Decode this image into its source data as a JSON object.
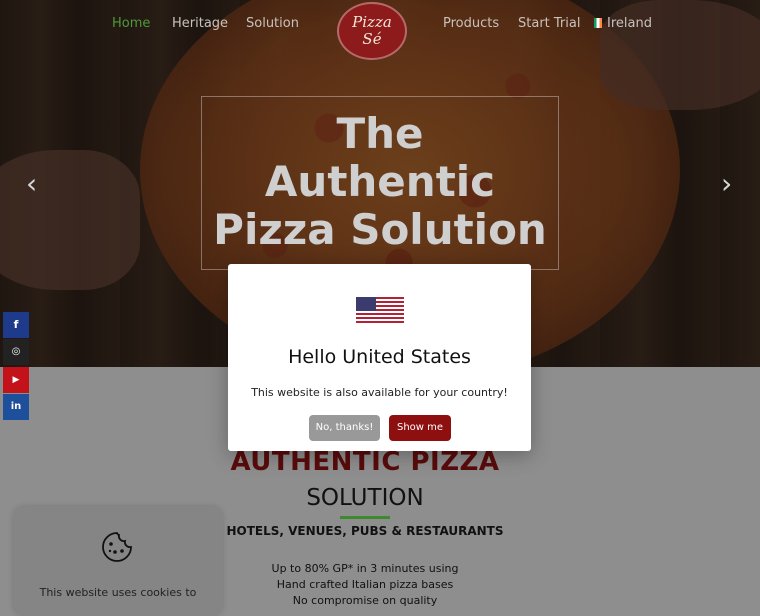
{
  "nav": {
    "left": [
      "Home",
      "Heritage",
      "Solution"
    ],
    "right": [
      "Products",
      "Start Trial"
    ],
    "country": "Ireland",
    "logo_line1": "Pizza",
    "logo_line2": "Sé"
  },
  "hero": {
    "title_line1": "The",
    "title_line2": "Authentic",
    "title_line3": "Pizza Solution",
    "prev_arrow": "‹",
    "next_arrow": "›"
  },
  "social": [
    {
      "icon": "facebook-icon",
      "glyph": "f",
      "color": "#1e3a8a"
    },
    {
      "icon": "instagram-icon",
      "glyph": "◎",
      "color": "#222222"
    },
    {
      "icon": "youtube-icon",
      "glyph": "▶",
      "color": "#c4121a"
    },
    {
      "icon": "linkedin-icon",
      "glyph": "in",
      "color": "#1e4f9a"
    }
  ],
  "content": {
    "heading_main": "AUTHENTIC PIZZA",
    "heading_sub": "SOLUTION",
    "heading_3": "HOTELS, VENUES, PUBS & RESTAURANTS",
    "line1": "Up to 80% GP* in 3 minutes using",
    "line2": "Hand crafted Italian pizza bases",
    "line3": "No compromise on quality"
  },
  "cookie": {
    "text": "This website uses cookies to"
  },
  "modal": {
    "title": "Hello United States",
    "text": "This website is also available for your country!",
    "no_label": "No, thanks!",
    "show_label": "Show me"
  },
  "colors": {
    "accent_red": "#8e0f0f",
    "accent_green": "#4e9a3a",
    "heading_red": "#5a0b0b"
  }
}
